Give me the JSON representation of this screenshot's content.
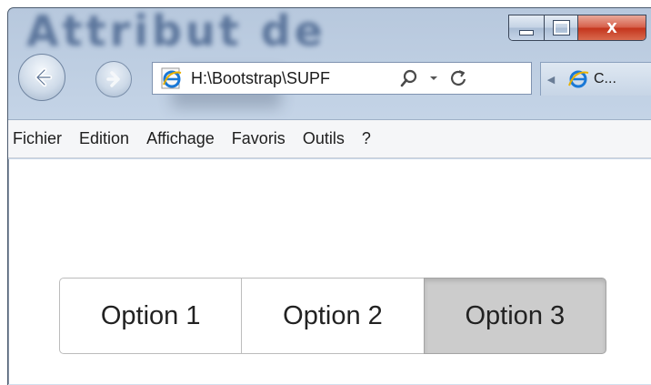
{
  "window": {
    "title_blurred": "Attribut de",
    "caption_close_label": "X"
  },
  "nav": {
    "address": "H:\\Bootstrap\\SUPF",
    "tab_label": "C..."
  },
  "menu": {
    "items": [
      "Fichier",
      "Edition",
      "Affichage",
      "Favoris",
      "Outils",
      "?"
    ]
  },
  "content": {
    "options": [
      "Option 1",
      "Option 2",
      "Option 3"
    ],
    "active_option": "Option 3"
  },
  "icons": {
    "back": "back-arrow-icon",
    "forward": "forward-arrow-icon",
    "page": "internet-explorer-icon",
    "search": "search-icon",
    "dropdown": "chevron-down-icon",
    "refresh": "refresh-icon",
    "tab_scroll": "tab-scroll-left-icon"
  },
  "colors": {
    "active_button": "#cccccc",
    "close_button": "#c4351c",
    "chrome": "#c9d8ea"
  }
}
